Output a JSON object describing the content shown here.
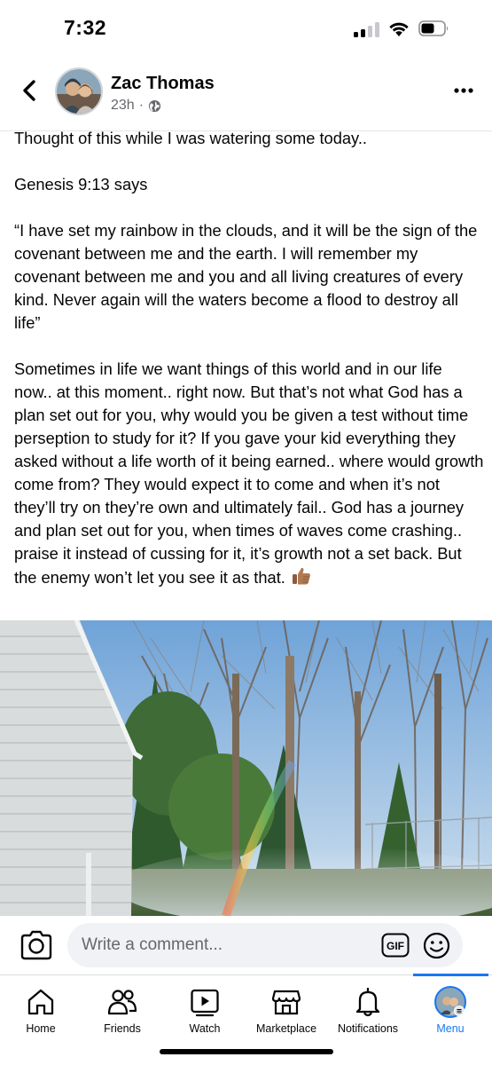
{
  "status_bar": {
    "time": "7:32"
  },
  "post": {
    "author": "Zac Thomas",
    "time_ago": "23h",
    "paragraphs": [
      "Thought of this while I was watering some today..",
      "Genesis 9:13 says",
      "“I have set my rainbow in the clouds, and it will be the sign of the covenant between me and the earth. I will remember my covenant between me and you and all living creatures of every kind. Never again will the waters become a flood to destroy all life”",
      "Sometimes in life we want things of this world and in our life now.. at this moment.. right now. But that’s not what God has a plan set out for you, why would you be given a test without time perseption to study for it? If you gave your kid everything they asked without a life worth of it being earned.. where would growth come from? They would expect it to come and when it’s not they’ll try on they’re own and ultimately fail.. God has a journey and plan set out for you, when times of waves come crashing.. praise  it instead of cussing for it, it’s growth not a set back. But the enemy won’t let you see it as that."
    ],
    "emoji": "thumbs-up-medium-skin-tone"
  },
  "comment_bar": {
    "placeholder": "Write a comment...",
    "gif_label": "GIF"
  },
  "nav": {
    "items": [
      {
        "label": "Home",
        "icon": "home-icon"
      },
      {
        "label": "Friends",
        "icon": "friends-icon"
      },
      {
        "label": "Watch",
        "icon": "watch-icon"
      },
      {
        "label": "Marketplace",
        "icon": "marketplace-icon"
      },
      {
        "label": "Notifications",
        "icon": "bell-icon"
      },
      {
        "label": "Menu",
        "icon": "menu-avatar-icon"
      }
    ],
    "active": "Menu"
  },
  "colors": {
    "accent": "#1877f2",
    "secondary_text": "#65676b",
    "input_bg": "#f0f2f5"
  }
}
